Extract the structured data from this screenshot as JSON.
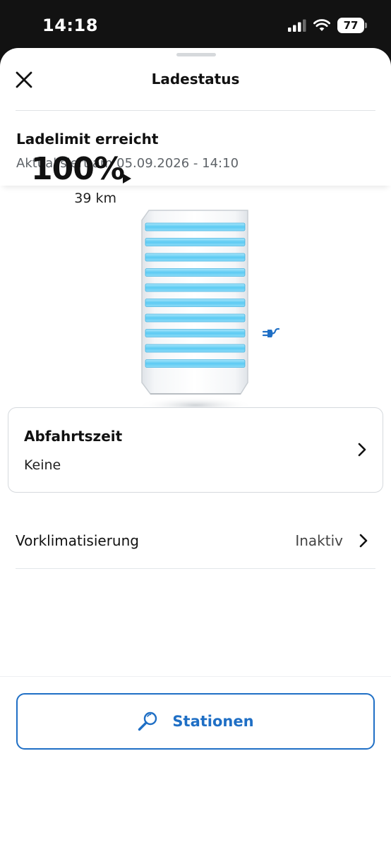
{
  "status_bar": {
    "time": "14:18",
    "battery_level": "77",
    "icons": [
      "cellular-signal-icon",
      "wifi-icon",
      "battery-icon"
    ]
  },
  "sheet": {
    "title": "Ladestatus",
    "close_icon": "close-icon"
  },
  "charge_status": {
    "title": "Ladelimit erreicht",
    "updated": "Aktualisiert am 05.09.2026 - 14:10"
  },
  "battery": {
    "percent_label": "100%",
    "percent_value": 100,
    "range": "39 km",
    "segments_filled": 10,
    "color_fill": "#6ccff6",
    "icon_plug": "plug-icon"
  },
  "departure": {
    "title": "Abfahrtszeit",
    "value": "Keine"
  },
  "preclimatization": {
    "label": "Vorklimatisierung",
    "value": "Inaktiv"
  },
  "stations_button": {
    "label": "Stationen",
    "icon": "search-icon"
  },
  "colors": {
    "accent": "#1f6fc5",
    "text": "#111111",
    "muted": "#5f6469"
  }
}
